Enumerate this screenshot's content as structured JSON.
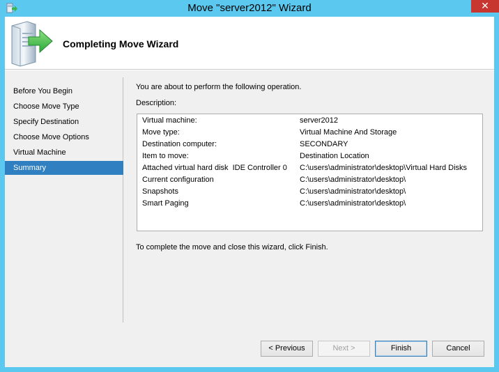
{
  "window": {
    "title": "Move \"server2012\" Wizard",
    "close_glyph": "✕"
  },
  "header": {
    "title": "Completing Move Wizard",
    "icon": "server-arrow-icon"
  },
  "nav": {
    "items": [
      {
        "label": "Before You Begin",
        "selected": false
      },
      {
        "label": "Choose Move Type",
        "selected": false
      },
      {
        "label": "Specify Destination",
        "selected": false
      },
      {
        "label": "Choose Move Options",
        "selected": false
      },
      {
        "label": "Virtual Machine",
        "selected": false
      },
      {
        "label": "Summary",
        "selected": true
      }
    ]
  },
  "content": {
    "intro": "You are about to perform the following operation.",
    "description_label": "Description:",
    "rows": [
      {
        "key": "Virtual machine:",
        "value": "server2012"
      },
      {
        "key": "Move type:",
        "value": "Virtual Machine And Storage"
      },
      {
        "key": "Destination computer:",
        "value": "SECONDARY"
      },
      {
        "key": "Item to move:",
        "value": "Destination Location"
      },
      {
        "key": "Attached virtual hard disk  IDE Controller 0",
        "value": "C:\\users\\administrator\\desktop\\Virtual Hard Disks"
      },
      {
        "key": "Current configuration",
        "value": "C:\\users\\administrator\\desktop\\"
      },
      {
        "key": "Snapshots",
        "value": "C:\\users\\administrator\\desktop\\"
      },
      {
        "key": "Smart Paging",
        "value": "C:\\users\\administrator\\desktop\\"
      }
    ],
    "finish_note": "To complete the move and close this wizard, click Finish."
  },
  "buttons": {
    "previous": "< Previous",
    "next": "Next >",
    "finish": "Finish",
    "cancel": "Cancel"
  },
  "colors": {
    "title_bar": "#5bc8ef",
    "selected_nav": "#2f7fc1",
    "close_button": "#c7372f"
  }
}
